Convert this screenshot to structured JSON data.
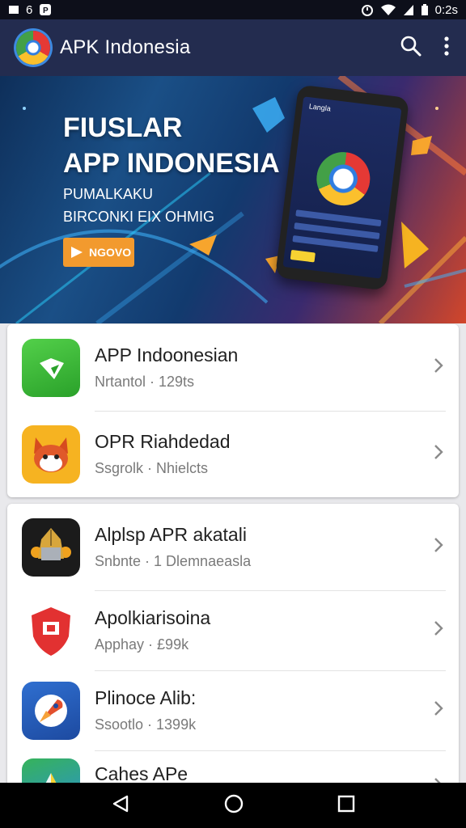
{
  "status_bar": {
    "left_number": "6",
    "time": "0:2s"
  },
  "app_bar": {
    "title": "APK Indonesia"
  },
  "banner": {
    "title_line1": "FIUSLAR",
    "title_line2": "APP INDONESIA",
    "subtitle_line1": "PUMALKAKU",
    "subtitle_line2": "BIRCONKI EIX OHMIG",
    "button_label": "NGOVO",
    "phone_header": "Langla"
  },
  "groups": [
    {
      "items": [
        {
          "name": "APP Indoonesian",
          "meta": "Nrtantol · 129ts",
          "icon": "green-app-icon",
          "color": "#3dbb3d"
        },
        {
          "name": "OPR Riahdedad",
          "meta": "Ssgrolk · Nhielcts",
          "icon": "fox-mascot-icon",
          "color": "#f6b321"
        }
      ]
    },
    {
      "items": [
        {
          "name": "Alplsp APR akatali",
          "meta": "Snbnte · 1 Dlemnaeasla",
          "icon": "robot-head-icon",
          "color": "#1b1b1b"
        },
        {
          "name": "Apolkiarisoina",
          "meta": "Apphay · £99k",
          "icon": "shield-icon",
          "color": "#e23131"
        },
        {
          "name": "Plinoce Alib:",
          "meta": "Ssootlo · 1399k",
          "icon": "rocket-icon",
          "color": "#2a5fb8"
        },
        {
          "name": "Cahes APe",
          "meta": "",
          "icon": "map-arrow-icon",
          "color": "#2a8fd6"
        }
      ]
    }
  ],
  "colors": {
    "app_bar": "#232c4f",
    "accent": "#f29a2e"
  }
}
